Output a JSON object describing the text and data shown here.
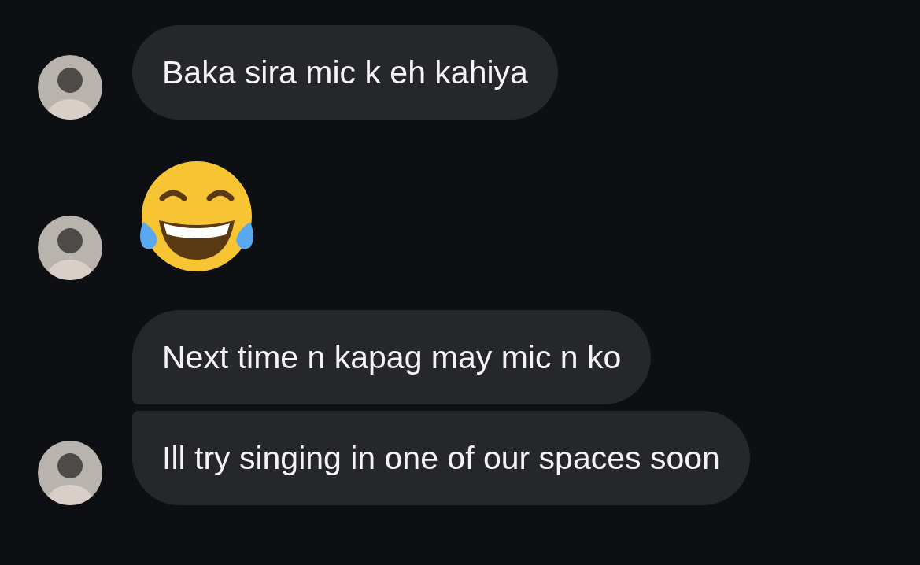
{
  "groups": [
    {
      "messages": [
        {
          "kind": "text",
          "text": "Baka sira mic k eh kahiya"
        }
      ]
    },
    {
      "messages": [
        {
          "kind": "emoji"
        }
      ]
    },
    {
      "messages": [
        {
          "kind": "text",
          "text": "Next time n kapag may mic n ko"
        },
        {
          "kind": "text",
          "text": "Ill try singing in one of our spaces soon"
        }
      ]
    }
  ]
}
